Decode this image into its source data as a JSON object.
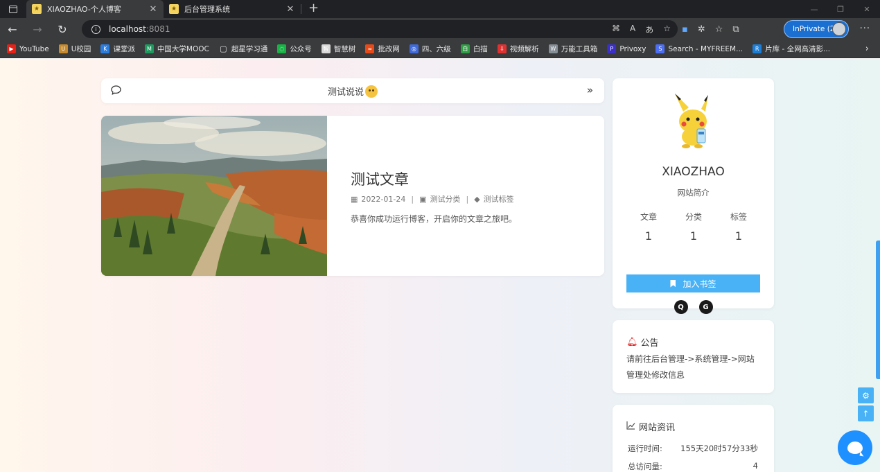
{
  "browser": {
    "tabs": [
      {
        "title": "XIAOZHAO-个人博客",
        "active": true
      },
      {
        "title": "后台管理系统",
        "active": false
      }
    ],
    "url_host": "localhost",
    "url_port": ":8081",
    "inprivate_label": "InPrivate (2)",
    "bookmarks": [
      {
        "label": "YouTube",
        "icon": "youtube-icon",
        "color": "#e62117",
        "glyph": "▶"
      },
      {
        "label": "U校园",
        "icon": "u-campus-icon",
        "color": "#c78b2d",
        "glyph": "U"
      },
      {
        "label": "课堂派",
        "icon": "ketangpai-icon",
        "color": "#2a7de1",
        "glyph": "K"
      },
      {
        "label": "中国大学MOOC",
        "icon": "mooc-icon",
        "color": "#1c9b5f",
        "glyph": "M"
      },
      {
        "label": "超星学习通",
        "icon": "page-icon",
        "color": "transparent",
        "glyph": "▢"
      },
      {
        "label": "公众号",
        "icon": "wechat-icon",
        "color": "#19b246",
        "glyph": "◌"
      },
      {
        "label": "智慧树",
        "icon": "zhihuishu-icon",
        "color": "#d9d9d9",
        "glyph": "智"
      },
      {
        "label": "批改网",
        "icon": "pigai-icon",
        "color": "#e64a19",
        "glyph": "∞"
      },
      {
        "label": "四、六级",
        "icon": "cet-icon",
        "color": "#3f6ad8",
        "glyph": "◎"
      },
      {
        "label": "白描",
        "icon": "baimiao-icon",
        "color": "#2f9e44",
        "glyph": "白"
      },
      {
        "label": "视频解析",
        "icon": "video-icon",
        "color": "#e03131",
        "glyph": "⇩"
      },
      {
        "label": "万能工具箱",
        "icon": "toolbox-icon",
        "color": "#868e96",
        "glyph": "W"
      },
      {
        "label": "Privoxy",
        "icon": "privoxy-icon",
        "color": "#3b2fc9",
        "glyph": "P"
      },
      {
        "label": "Search - MYFREEM...",
        "icon": "search-icon",
        "color": "#4c6ef5",
        "glyph": "S"
      },
      {
        "label": "片库 - 全网高清影...",
        "icon": "pianku-icon",
        "color": "#1c7ed6",
        "glyph": "R"
      }
    ]
  },
  "talk": {
    "label": "测试说说"
  },
  "post": {
    "title": "测试文章",
    "date": "2022-01-24",
    "category": "测试分类",
    "tag": "测试标签",
    "excerpt": "恭喜你成功运行博客，开启你的文章之旅吧。"
  },
  "profile": {
    "name": "XIAOZHAO",
    "description": "网站简介",
    "stats": [
      {
        "label": "文章",
        "value": "1"
      },
      {
        "label": "分类",
        "value": "1"
      },
      {
        "label": "标签",
        "value": "1"
      }
    ],
    "bookmark_button": "加入书签"
  },
  "notice": {
    "title": "公告",
    "body": "请前往后台管理->系统管理->网站管理处修改信息"
  },
  "site_info": {
    "title": "网站资讯",
    "rows": [
      {
        "label": "运行时间:",
        "value": "155天20时57分33秒"
      },
      {
        "label": "总访问量:",
        "value": "4"
      }
    ]
  },
  "colors": {
    "accent": "#49b1f5",
    "bell": "#e02020",
    "chat": "#1e90ff"
  }
}
